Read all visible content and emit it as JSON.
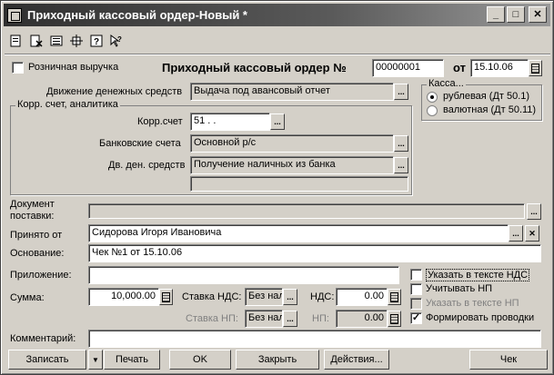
{
  "window": {
    "title": "Приходный кассовый ордер-Новый *",
    "controls": {
      "minimize": "_",
      "maximize": "□",
      "close": "✕"
    }
  },
  "toolbar": {
    "icons": [
      "doc-view-icon",
      "doc-delete-icon",
      "doc-list-icon",
      "doc-move-icon",
      "help-icon",
      "help-pointer-icon"
    ]
  },
  "header": {
    "retail_label": "Розничная выручка",
    "retail_checked": false,
    "doc_title": "Приходный кассовый ордер №",
    "number": "00000001",
    "date_label": "от",
    "date": "15.10.06"
  },
  "cash_flow": {
    "label": "Движение денежных средств",
    "value": "Выдача под авансовый отчет"
  },
  "corr_group": {
    "title": "Корр. счет, аналитика",
    "account_label": "Корр.счет",
    "account_value": "51 . .",
    "bank_label": "Банковские счета",
    "bank_value": "Основной р/с",
    "flow_label": "Дв. ден. средств",
    "flow_value": "Получение наличных из банка",
    "extra_value": ""
  },
  "cash_group": {
    "title": "Касса...",
    "options": [
      "рублевая (Дт 50.1)",
      "валютная (Дт 50.11)"
    ],
    "selected": 0
  },
  "supply": {
    "label": "Документ поставки:",
    "value": ""
  },
  "received_from": {
    "label": "Принято от",
    "value": "Сидорова Игоря Ивановича"
  },
  "basis": {
    "label": "Основание:",
    "value": "Чек №1 от 15.10.06"
  },
  "attachment": {
    "label": "Приложение:",
    "value": ""
  },
  "sum": {
    "label": "Сумма:",
    "value": "10,000.00"
  },
  "vat_rate": {
    "label": "Ставка НДС:",
    "value": "Без нал"
  },
  "vat": {
    "label": "НДС:",
    "value": "0.00"
  },
  "np_rate": {
    "label": "Ставка НП:",
    "value": "Без нал"
  },
  "np": {
    "label": "НП:",
    "value": "0.00"
  },
  "options": [
    {
      "label": "Указать в тексте НДС",
      "checked": false,
      "enabled": true
    },
    {
      "label": "Учитывать НП",
      "checked": false,
      "enabled": true
    },
    {
      "label": "Указать в тексте НП",
      "checked": false,
      "enabled": false
    },
    {
      "label": "Формировать проводки",
      "checked": true,
      "enabled": true
    }
  ],
  "comment": {
    "label": "Комментарий:",
    "value": ""
  },
  "buttons": {
    "record": "Записать",
    "print": "Печать",
    "ok": "OK",
    "close": "Закрыть",
    "actions": "Действия...",
    "receipt": "Чек"
  }
}
